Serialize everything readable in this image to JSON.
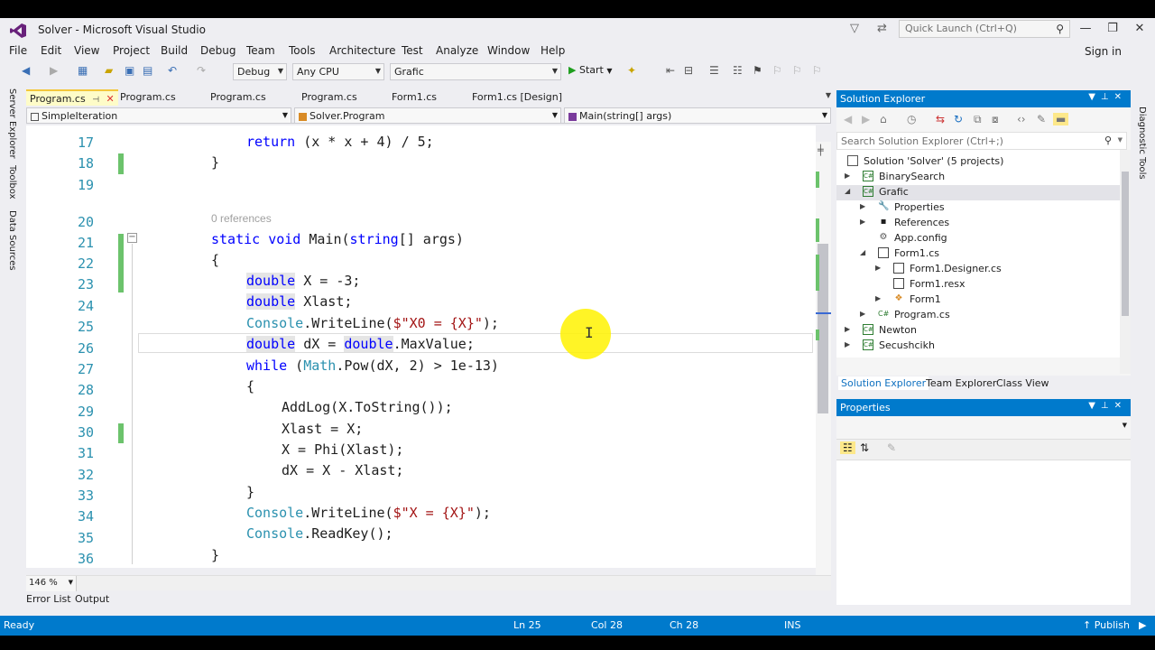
{
  "window": {
    "title": "Solver - Microsoft Visual Studio",
    "quick_launch_placeholder": "Quick Launch (Ctrl+Q)",
    "sign_in": "Sign in"
  },
  "menu": [
    "File",
    "Edit",
    "View",
    "Project",
    "Build",
    "Debug",
    "Team",
    "Tools",
    "Architecture",
    "Test",
    "Analyze",
    "Window",
    "Help"
  ],
  "toolbar": {
    "config": "Debug",
    "platform": "Any CPU",
    "startup_project": "Grafic",
    "start_label": "Start"
  },
  "left_rail": [
    "Server Explorer",
    "Toolbox",
    "Data Sources"
  ],
  "right_rail": [
    "Diagnostic Tools"
  ],
  "doc_tabs": [
    {
      "label": "Program.cs",
      "active": true
    },
    {
      "label": "Program.cs",
      "active": false
    },
    {
      "label": "Program.cs",
      "active": false
    },
    {
      "label": "Program.cs",
      "active": false
    },
    {
      "label": "Form1.cs",
      "active": false
    },
    {
      "label": "Form1.cs [Design]",
      "active": false
    }
  ],
  "navbar": {
    "project": "SimpleIteration",
    "type": "Solver.Program",
    "member": "Main(string[] args)"
  },
  "editor": {
    "codelens": "0 references",
    "line_numbers": [
      "17",
      "18",
      "19",
      "20",
      "21",
      "22",
      "23",
      "24",
      "25",
      "26",
      "27",
      "28",
      "29",
      "30",
      "31",
      "32",
      "33",
      "34",
      "35",
      "36"
    ],
    "zoom": "146 %"
  },
  "code": {
    "l17_kw": "return",
    "l17_rest": " (x * x + 4) / 5;",
    "l18": "}",
    "l20_kw1": "static",
    "l20_kw2": "void",
    "l20_name": " Main(",
    "l20_kw3": "string",
    "l20_rest": "[] args)",
    "l21": "{",
    "l22_kw": "double",
    "l22_rest": " X = -3;",
    "l23_kw": "double",
    "l23_rest": " Xlast;",
    "l24_typ": "Console",
    "l24_mid": ".WriteLine(",
    "l24_str": "$\"X0 = {X}\"",
    "l24_end": ");",
    "l25_kw": "double",
    "l25_mid": " dX = ",
    "l25_kw2": "double",
    "l25_end": ".MaxValue;",
    "l26_kw": "while",
    "l26_a": " (",
    "l26_typ": "Math",
    "l26_rest": ".Pow(dX, 2) > 1e-13)",
    "l27": "{",
    "l28": "AddLog(X.ToString());",
    "l29": "Xlast = X;",
    "l30": "X = Phi(Xlast);",
    "l31": "dX = X - Xlast;",
    "l32": "}",
    "l33_typ": "Console",
    "l33_mid": ".WriteLine(",
    "l33_str": "$\"X = {X}\"",
    "l33_end": ");",
    "l34_typ": "Console",
    "l34_rest": ".ReadKey();",
    "l35": "}",
    "l36": "}"
  },
  "bottom_tabs": [
    "Error List",
    "Output"
  ],
  "status": {
    "state": "Ready",
    "ln": "Ln 25",
    "col": "Col 28",
    "ch": "Ch 28",
    "ins": "INS",
    "publish": "Publish"
  },
  "solution_explorer": {
    "title": "Solution Explorer",
    "search_placeholder": "Search Solution Explorer (Ctrl+;)",
    "items": [
      {
        "label": "Solution 'Solver' (5 projects)",
        "icon": "solution-icon",
        "depth": 0,
        "arrow": ""
      },
      {
        "label": "BinarySearch",
        "icon": "csproj-icon",
        "depth": 0,
        "arrow": "▶"
      },
      {
        "label": "Grafic",
        "icon": "csproj-icon",
        "depth": 0,
        "arrow": "◢",
        "selected": true
      },
      {
        "label": "Properties",
        "icon": "wrench-icon",
        "depth": 1,
        "arrow": "▶"
      },
      {
        "label": "References",
        "icon": "references-icon",
        "depth": 1,
        "arrow": "▶"
      },
      {
        "label": "App.config",
        "icon": "config-icon",
        "depth": 1,
        "arrow": ""
      },
      {
        "label": "Form1.cs",
        "icon": "form-icon",
        "depth": 1,
        "arrow": "◢"
      },
      {
        "label": "Form1.Designer.cs",
        "icon": "csfile-icon",
        "depth": 2,
        "arrow": "▶"
      },
      {
        "label": "Form1.resx",
        "icon": "resx-icon",
        "depth": 2,
        "arrow": ""
      },
      {
        "label": "Form1",
        "icon": "class-icon",
        "depth": 2,
        "arrow": "▶"
      },
      {
        "label": "Program.cs",
        "icon": "csfile-icon",
        "depth": 1,
        "arrow": "▶"
      },
      {
        "label": "Newton",
        "icon": "csproj-icon",
        "depth": 0,
        "arrow": "▶"
      },
      {
        "label": "Secushcikh",
        "icon": "csproj-icon",
        "depth": 0,
        "arrow": "▶"
      }
    ],
    "tabs": [
      "Solution Explorer",
      "Team Explorer",
      "Class View"
    ]
  },
  "properties": {
    "title": "Properties"
  },
  "colors": {
    "accent": "#007acc",
    "keyword": "#0000ff",
    "type": "#2b91af",
    "string": "#a31515",
    "change_bar": "#6cc36c",
    "cursor_highlight": "#fff200"
  }
}
